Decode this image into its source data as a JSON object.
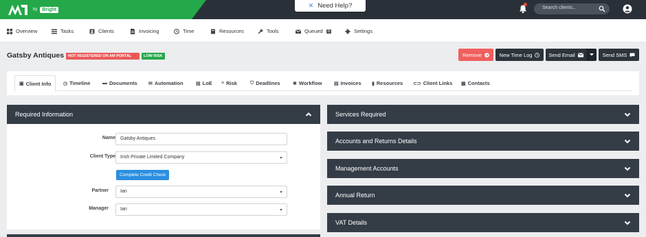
{
  "topbar": {
    "logo_by": "by",
    "logo_bright": "Bright",
    "help_label": "Need Help?",
    "search_placeholder": "Search clients..."
  },
  "nav": {
    "items": [
      {
        "label": "Overview",
        "icon": "grid-icon"
      },
      {
        "label": "Tasks",
        "icon": "list-icon"
      },
      {
        "label": "Clients",
        "icon": "clients-icon"
      },
      {
        "label": "Invoicing",
        "icon": "invoice-icon"
      },
      {
        "label": "Time",
        "icon": "clock-icon"
      },
      {
        "label": "Resources",
        "icon": "book-icon"
      },
      {
        "label": "Tools",
        "icon": "wrench-icon"
      },
      {
        "label": "Queued",
        "icon": "mail-icon",
        "badge": "0"
      },
      {
        "label": "Settings",
        "icon": "gear-icon"
      }
    ]
  },
  "client": {
    "name": "Gatsby Antiques",
    "badge_portal": "NOT REGISTERED ON AM PORTAL",
    "badge_risk": "LOW RISK"
  },
  "actions": {
    "remove": "Remove",
    "time_log": "New Time Log",
    "send_email": "Send Email",
    "send_sms": "Send SMS"
  },
  "tabs": [
    {
      "label": "Client Info",
      "icon": "id-card-icon"
    },
    {
      "label": "Timeline",
      "icon": "clock-icon"
    },
    {
      "label": "Documents",
      "icon": "folder-icon"
    },
    {
      "label": "Automation",
      "icon": "envelope-icon"
    },
    {
      "label": "LoE",
      "icon": "file-icon"
    },
    {
      "label": "Risk",
      "icon": "list-icon"
    },
    {
      "label": "Deadlines",
      "icon": "shield-icon"
    },
    {
      "label": "Workflow",
      "icon": "gear-icon"
    },
    {
      "label": "Invoices",
      "icon": "file-icon"
    },
    {
      "label": "Resources",
      "icon": "bookmark-icon"
    },
    {
      "label": "Client Links",
      "icon": "link-icon"
    },
    {
      "label": "Contacts",
      "icon": "contacts-icon"
    }
  ],
  "required_info": {
    "title": "Required Information",
    "name_label": "Name",
    "name_value": "Gatsby Antiques",
    "client_type_label": "Client Type",
    "client_type_value": "Irish Private Limited Company",
    "credit_check": "Complete Credit Check",
    "partner_label": "Partner",
    "partner_value": "Ian",
    "manager_label": "Manager",
    "manager_value": "Ian"
  },
  "right_panels": [
    "Services Required",
    "Accounts and Returns Details",
    "Management Accounts",
    "Annual Return",
    "VAT Details"
  ]
}
